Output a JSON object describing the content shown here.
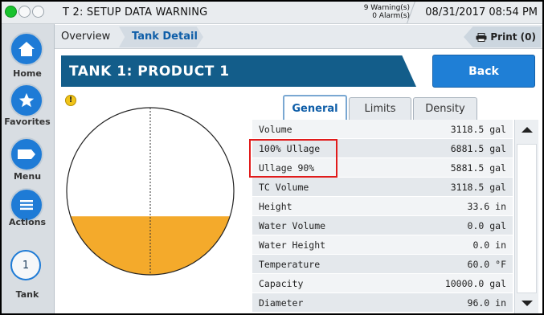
{
  "status": {
    "title": "T 2: SETUP DATA WARNING",
    "warnings": "9 Warning(s)",
    "alarms": "0 Alarm(s)",
    "datetime": "08/31/2017 08:54 PM"
  },
  "nav": {
    "home": "Home",
    "favorites": "Favorites",
    "menu": "Menu",
    "actions": "Actions",
    "tank_number": "1",
    "tank": "Tank"
  },
  "breadcrumb": {
    "overview": "Overview",
    "tank_detail": "Tank Detail",
    "print": "Print (0)"
  },
  "header": {
    "title": "TANK 1: PRODUCT 1",
    "back": "Back"
  },
  "tabs": [
    {
      "label": "General",
      "active": true
    },
    {
      "label": "Limits",
      "active": false
    },
    {
      "label": "Density",
      "active": false
    }
  ],
  "rows": [
    {
      "label": "Volume",
      "value": "3118.5 gal"
    },
    {
      "label": "100% Ullage",
      "value": "6881.5 gal"
    },
    {
      "label": "Ullage 90%",
      "value": "5881.5 gal"
    },
    {
      "label": "TC Volume",
      "value": "3118.5 gal"
    },
    {
      "label": "Height",
      "value": "33.6 in"
    },
    {
      "label": "Water Volume",
      "value": "0.0 gal"
    },
    {
      "label": "Water Height",
      "value": "0.0 in"
    },
    {
      "label": "Temperature",
      "value": "60.0 °F"
    },
    {
      "label": "Capacity",
      "value": "10000.0 gal"
    },
    {
      "label": "Diameter",
      "value": "96.0 in"
    }
  ],
  "tank_fill_fraction": 0.35,
  "colors": {
    "fill": "#f4aa2b",
    "accent": "#1f7fd6",
    "header": "#135d8a",
    "highlight": "#e11b1b"
  }
}
